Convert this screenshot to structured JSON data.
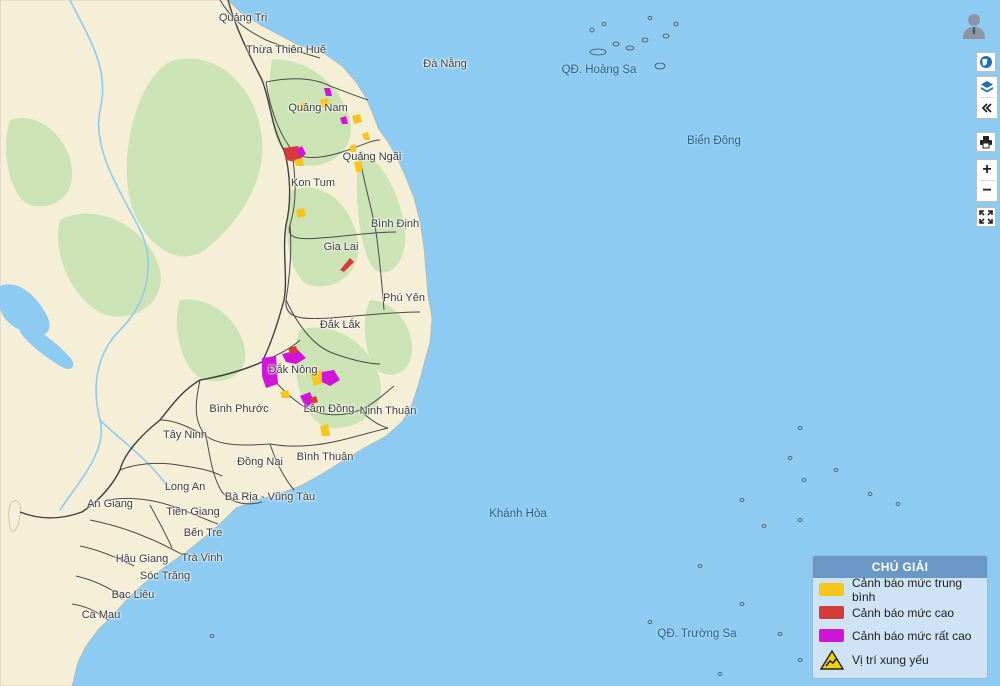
{
  "map": {
    "places": [
      {
        "name": "Quảng Trị",
        "type": "province"
      },
      {
        "name": "Thừa Thiên Huế",
        "type": "province"
      },
      {
        "name": "Đà Nẵng",
        "type": "province"
      },
      {
        "name": "Quảng Nam",
        "type": "province"
      },
      {
        "name": "Quảng Ngãi",
        "type": "province"
      },
      {
        "name": "Kon Tum",
        "type": "province"
      },
      {
        "name": "Bình Định",
        "type": "province"
      },
      {
        "name": "Gia Lai",
        "type": "province"
      },
      {
        "name": "Phú Yên",
        "type": "province"
      },
      {
        "name": "Đắk Lắk",
        "type": "province"
      },
      {
        "name": "Đắk Nông",
        "type": "province"
      },
      {
        "name": "Bình Phước",
        "type": "province"
      },
      {
        "name": "Lâm Đồng",
        "type": "province"
      },
      {
        "name": "Ninh Thuận",
        "type": "province"
      },
      {
        "name": "Tây Ninh",
        "type": "province"
      },
      {
        "name": "Đồng Nai",
        "type": "province"
      },
      {
        "name": "Bình Thuận",
        "type": "province"
      },
      {
        "name": "Long An",
        "type": "province"
      },
      {
        "name": "Bà Rịa - Vũng Tàu",
        "type": "province"
      },
      {
        "name": "An Giang",
        "type": "province"
      },
      {
        "name": "Tiền Giang",
        "type": "province"
      },
      {
        "name": "Bến Tre",
        "type": "province"
      },
      {
        "name": "Hậu Giang",
        "type": "province"
      },
      {
        "name": "Trà Vinh",
        "type": "province"
      },
      {
        "name": "Sóc Trăng",
        "type": "province"
      },
      {
        "name": "Bạc Liêu",
        "type": "province"
      },
      {
        "name": "Cà Mau",
        "type": "province"
      },
      {
        "name": "QĐ. Hoàng Sa",
        "type": "sea"
      },
      {
        "name": "Biển Đông",
        "type": "sea"
      },
      {
        "name": "Khánh Hòa",
        "type": "sea"
      },
      {
        "name": "QĐ. Trường Sa",
        "type": "sea"
      }
    ],
    "colors": {
      "sea": "#8ecbf2",
      "land": "#f4efd6",
      "forest": "#c6e3b0",
      "border": "#555555",
      "warning_medium": "#f8c51b",
      "warning_high": "#d63a3a",
      "warning_very_high": "#d014d8"
    }
  },
  "controls": {
    "user_icon": "user-icon",
    "globe": "globe-icon",
    "layers": "layers-icon",
    "collapse": "double-chevron-left-icon",
    "print": "printer-icon",
    "zoom_in": "+",
    "zoom_out": "−",
    "fullscreen": "fullscreen-icon"
  },
  "legend": {
    "title": "CHÚ GIẢI",
    "items": [
      {
        "label": "Cảnh báo mức trung bình",
        "color": "#f8c51b",
        "kind": "swatch"
      },
      {
        "label": "Cảnh báo mức cao",
        "color": "#d63a3a",
        "kind": "swatch"
      },
      {
        "label": "Cảnh báo mức rất cao",
        "color": "#d014d8",
        "kind": "swatch"
      },
      {
        "label": "Vị trí xung yếu",
        "color": "#f2d000",
        "kind": "warning-icon"
      }
    ]
  }
}
